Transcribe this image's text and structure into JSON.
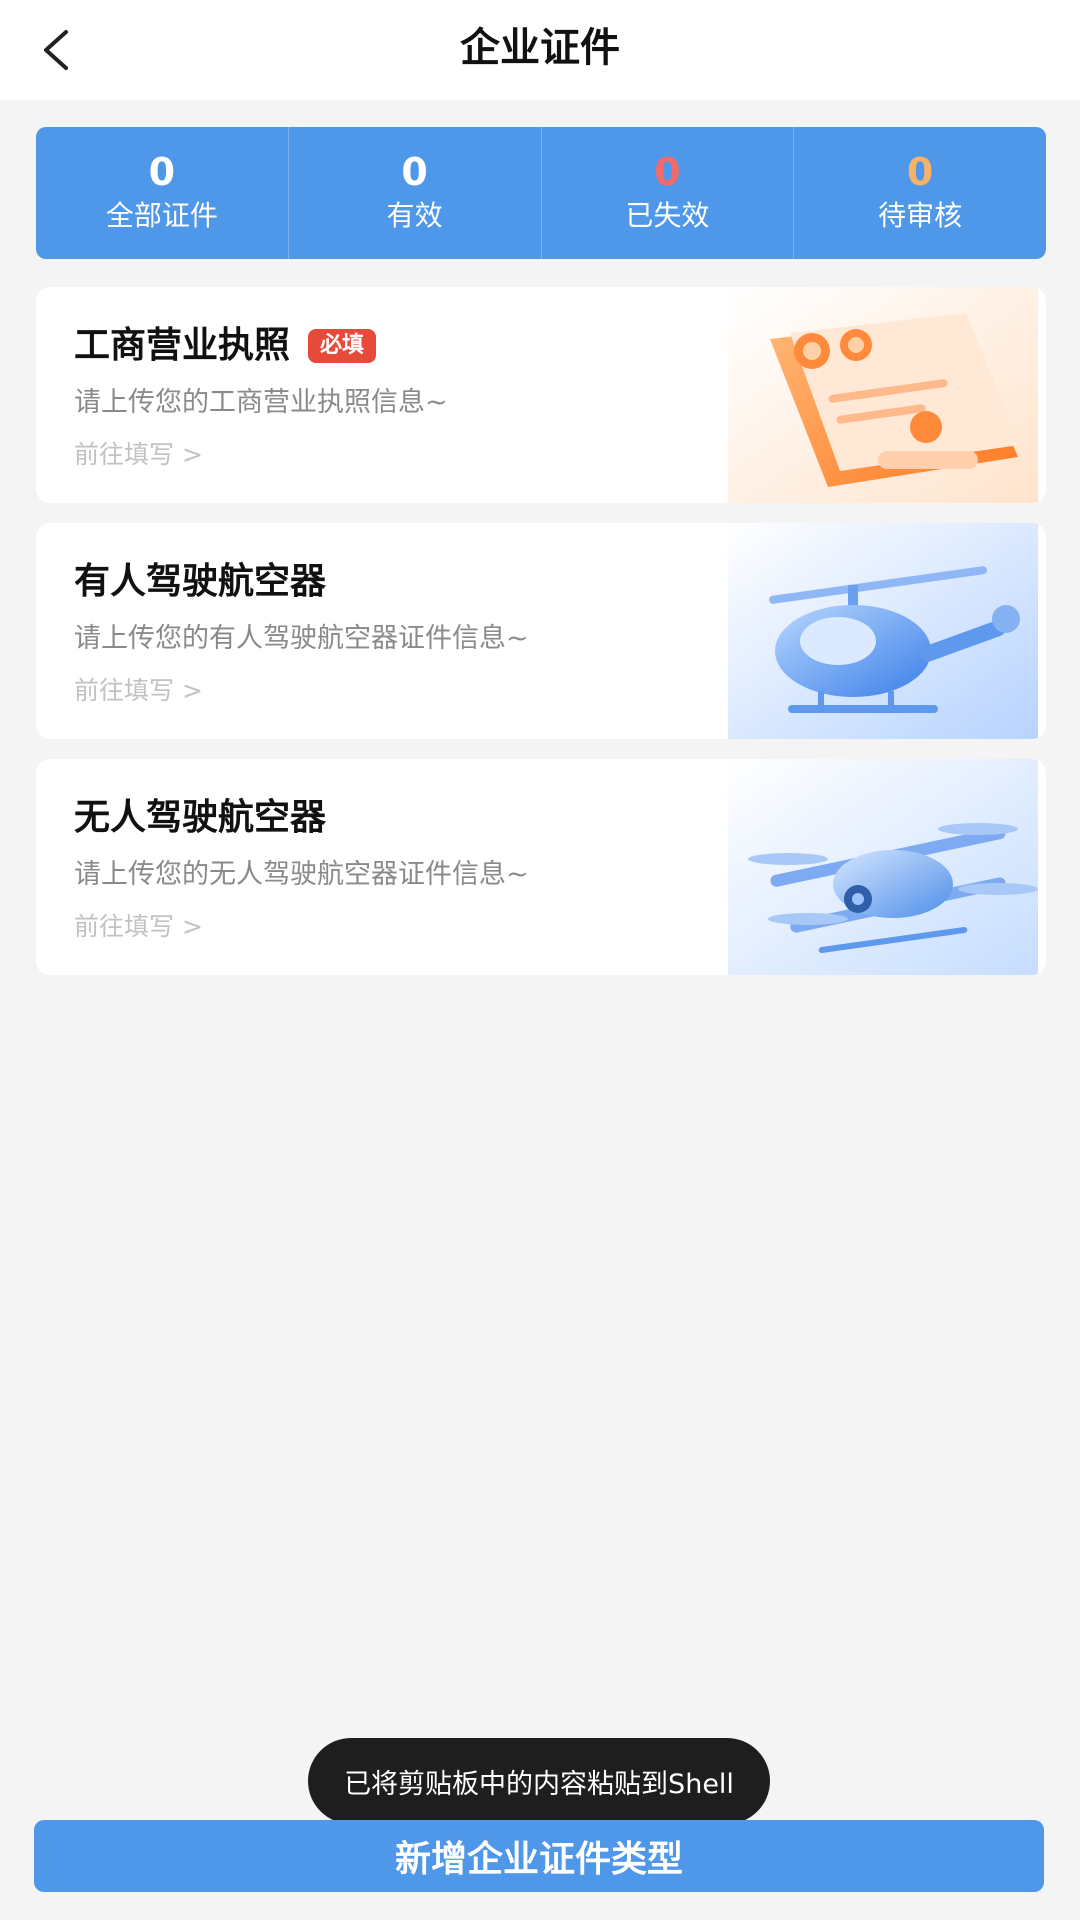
{
  "header": {
    "title": "企业证件",
    "back_icon": "chevron-left-icon"
  },
  "stats": [
    {
      "value": "0",
      "label": "全部证件",
      "color": "#ffffff"
    },
    {
      "value": "0",
      "label": "有效",
      "color": "#ffffff"
    },
    {
      "value": "0",
      "label": "已失效",
      "color": "#f46a6a"
    },
    {
      "value": "0",
      "label": "待审核",
      "color": "#f7b26a"
    }
  ],
  "cards": [
    {
      "title": "工商营业执照",
      "badge": "必填",
      "desc": "请上传您的工商营业执照信息~",
      "link": "前往填写 >",
      "icon": "business-license-icon"
    },
    {
      "title": "有人驾驶航空器",
      "desc": "请上传您的有人驾驶航空器证件信息~",
      "link": "前往填写 >",
      "icon": "helicopter-icon"
    },
    {
      "title": "无人驾驶航空器",
      "desc": "请上传您的无人驾驶航空器证件信息~",
      "link": "前往填写 >",
      "icon": "drone-icon"
    }
  ],
  "toast": "已将剪贴板中的内容粘贴到Shell",
  "bottom_button": "新增企业证件类型",
  "colors": {
    "accent": "#4f97e8",
    "badge": "#e64a3b",
    "background": "#f4f4f5"
  }
}
